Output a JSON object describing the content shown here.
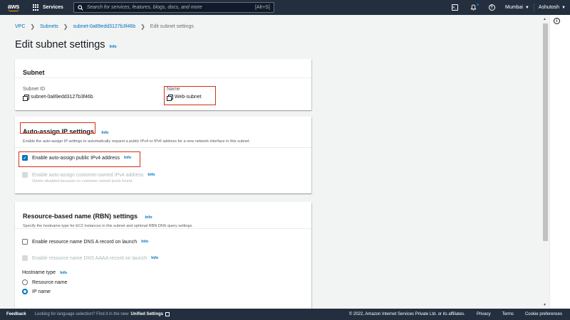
{
  "nav": {
    "logo": "aws",
    "services": "Services",
    "search_placeholder": "Search for services, features, blogs, docs, and more",
    "search_shortcut": "[Alt+S]",
    "region": "Mumbai",
    "account": "Ashutosh",
    "cloudshell_glyph": ">_",
    "help_glyph": "?",
    "icons": [
      "grid-icon",
      "search-icon",
      "cloudshell-icon",
      "bell-icon",
      "help-icon"
    ]
  },
  "breadcrumb": {
    "items": [
      "VPC",
      "Subnets",
      "subnet-0a89edd3127b3f46b"
    ],
    "current": "Edit subnet settings"
  },
  "page": {
    "title": "Edit subnet settings",
    "info": "Info"
  },
  "subnet_panel": {
    "heading": "Subnet",
    "id_label": "Subnet ID",
    "id_value": "subnet-0a89edd3127b3f46b",
    "name_label": "Name",
    "name_value": "Web-subnet"
  },
  "auto_assign": {
    "heading": "Auto-assign IP settings",
    "info": "Info",
    "description": "Enable the auto-assign IP settings to automatically request a public IPv4 or IPv6 address for a new network interface in this subnet.",
    "ipv4_label": "Enable auto-assign public IPv4 address",
    "ipv4_checked": true,
    "ipv4_info": "Info",
    "customer_label": "Enable auto-assign customer-owned IPv4 address",
    "customer_info": "Info",
    "customer_note": "Option disabled because no customer owned pools found."
  },
  "rbn": {
    "heading": "Resource-based name (RBN) settings",
    "info": "Info",
    "description": "Specify the hostname type for EC2 instances in this subnet and optional RBN DNS query settings.",
    "dns_a_label": "Enable resource name DNS A record on launch",
    "dns_a_info": "Info",
    "dns_aaaa_label": "Enable resource name DNS AAAA record on launch",
    "dns_aaaa_info": "Info",
    "hostname_label": "Hostname type",
    "hostname_info": "Info",
    "options": [
      "Resource name",
      "IP name"
    ],
    "selected": "IP name"
  },
  "footer": {
    "feedback": "Feedback",
    "language_prompt": "Looking for language selection? Find it in the new",
    "unified_settings": "Unified Settings",
    "copyright": "© 2022, Amazon Internet Services Private Ltd. or its affiliates.",
    "privacy": "Privacy",
    "terms": "Terms",
    "cookies": "Cookie preferences"
  },
  "colors": {
    "nav_bg": "#232f3e",
    "link": "#0073bb",
    "highlight_box": "#d13212",
    "logo_smile": "#ff9900"
  }
}
